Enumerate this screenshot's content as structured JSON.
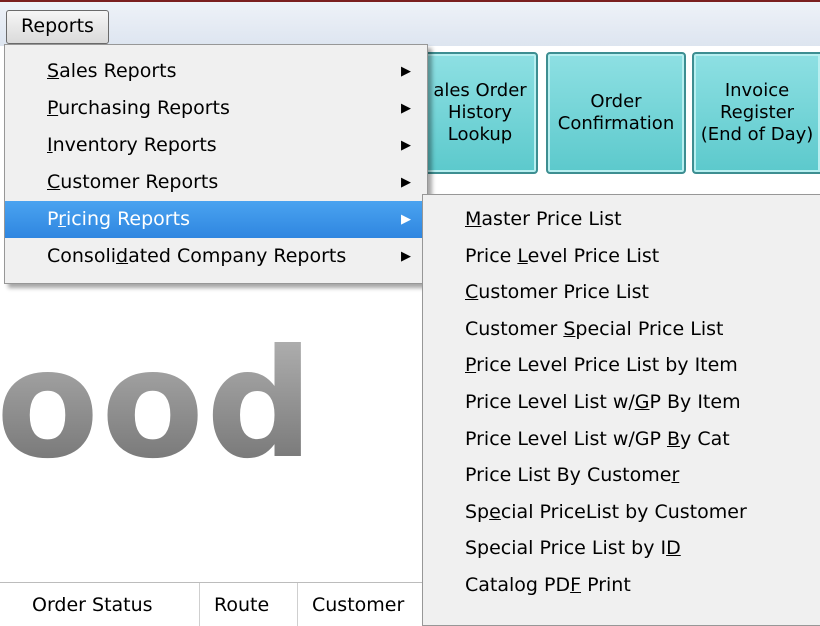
{
  "menubar": {
    "reports": "Reports"
  },
  "toolbar": {
    "sales_order_history": "ales Order\nHistory\nLookup",
    "order_confirmation": "Order\nConfirmation",
    "invoice_register": "Invoice\nRegister\n(End of Day)"
  },
  "hero": {
    "text": "ood"
  },
  "grid": {
    "columns": [
      "Order Status",
      "Route",
      "Customer"
    ]
  },
  "reports_menu": {
    "items": [
      {
        "pre": "",
        "acc": "S",
        "post": "ales Reports"
      },
      {
        "pre": "",
        "acc": "P",
        "post": "urchasing Reports"
      },
      {
        "pre": "",
        "acc": "I",
        "post": "nventory Reports"
      },
      {
        "pre": "",
        "acc": "C",
        "post": "ustomer Reports"
      },
      {
        "pre": "P",
        "acc": "r",
        "post": "icing Reports"
      },
      {
        "pre": "Consoli",
        "acc": "d",
        "post": "ated Company Reports"
      }
    ],
    "arrow": "▶"
  },
  "pricing_menu": {
    "items": [
      {
        "pre": "",
        "acc": "M",
        "post": "aster Price List"
      },
      {
        "pre": "Price ",
        "acc": "L",
        "post": "evel Price List"
      },
      {
        "pre": "",
        "acc": "C",
        "post": "ustomer Price List"
      },
      {
        "pre": "Customer ",
        "acc": "S",
        "post": "pecial Price List"
      },
      {
        "pre": "",
        "acc": "P",
        "post": "rice Level Price List by Item"
      },
      {
        "pre": "Price Level List w/",
        "acc": "G",
        "post": "P By Item"
      },
      {
        "pre": "Price Level List w/GP ",
        "acc": "B",
        "post": "y Cat"
      },
      {
        "pre": "Price List By Custome",
        "acc": "r",
        "post": ""
      },
      {
        "pre": "Sp",
        "acc": "e",
        "post": "cial PriceList by Customer"
      },
      {
        "pre": "Special Price List by I",
        "acc": "D",
        "post": ""
      },
      {
        "pre": "Catalog PD",
        "acc": "F",
        "post": " Print"
      }
    ]
  },
  "colors": {
    "highlight": "#3392e6",
    "toolbar_button": "#6fd3d6",
    "accent_border": "#7a1f1f"
  }
}
